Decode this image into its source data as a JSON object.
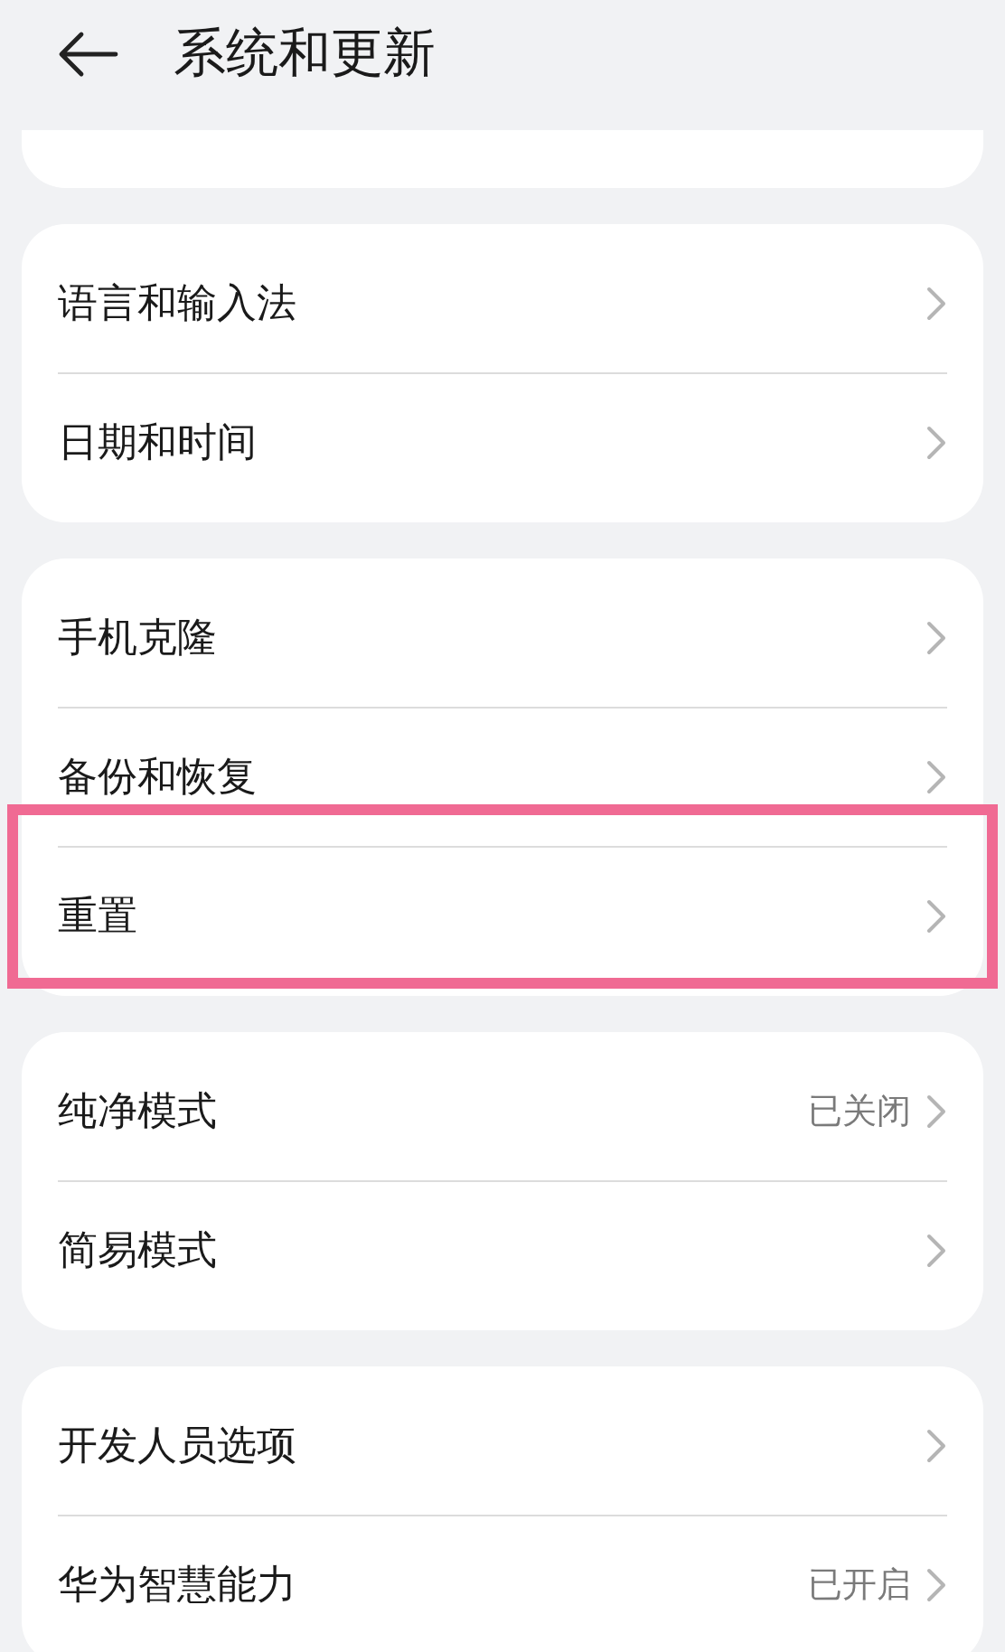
{
  "header": {
    "title": "系统和更新"
  },
  "groups": [
    {
      "items": [
        {
          "label": "语言和输入法",
          "highlighted": false
        },
        {
          "label": "日期和时间",
          "highlighted": false
        }
      ]
    },
    {
      "items": [
        {
          "label": "手机克隆",
          "highlighted": false
        },
        {
          "label": "备份和恢复",
          "highlighted": false
        },
        {
          "label": "重置",
          "highlighted": true
        }
      ]
    },
    {
      "items": [
        {
          "label": "纯净模式",
          "value": "已关闭",
          "highlighted": false
        },
        {
          "label": "简易模式",
          "highlighted": false
        }
      ]
    },
    {
      "items": [
        {
          "label": "开发人员选项",
          "highlighted": false
        },
        {
          "label": "华为智慧能力",
          "value": "已开启",
          "highlighted": false
        }
      ]
    }
  ]
}
